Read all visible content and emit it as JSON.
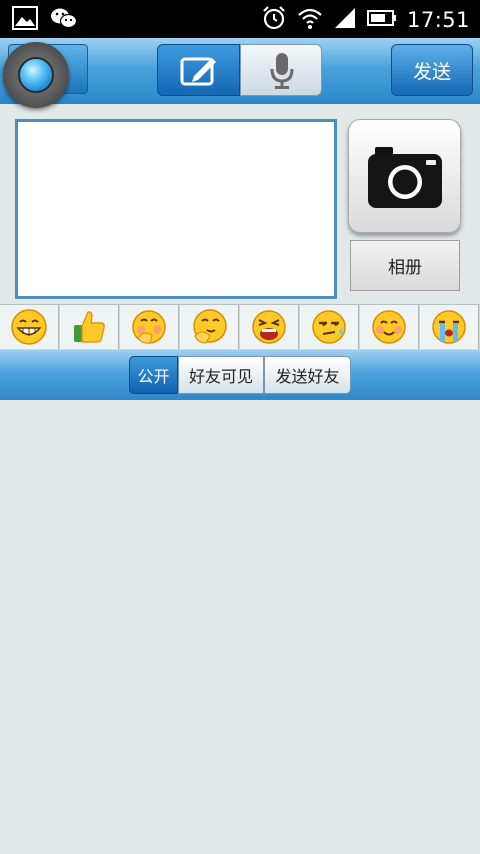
{
  "statusbar": {
    "time": "17:51",
    "left_icons": [
      "image-icon",
      "wechat-icon"
    ],
    "right_icons": [
      "alarm-icon",
      "wifi-icon",
      "signal-icon",
      "battery-icon"
    ]
  },
  "toolbar": {
    "back_icon": "camera-lens-avatar-icon",
    "tabs": [
      {
        "name": "write",
        "icon": "edit-icon",
        "selected": true
      },
      {
        "name": "voice",
        "icon": "microphone-icon",
        "selected": false
      }
    ],
    "send_label": "发送"
  },
  "compose": {
    "text_value": "",
    "camera_icon": "camera-icon",
    "album_label": "相册"
  },
  "emoji_bar": {
    "emojis": [
      "😁",
      "👍",
      "🤭",
      "🤔",
      "😫",
      "😒",
      "😊",
      "😭"
    ]
  },
  "scope": {
    "options": [
      "公开",
      "好友可见",
      "发送好友"
    ],
    "selected": "公开"
  },
  "colors": {
    "accent_blue": "#2a86c8",
    "background": "#e1e9e8"
  }
}
